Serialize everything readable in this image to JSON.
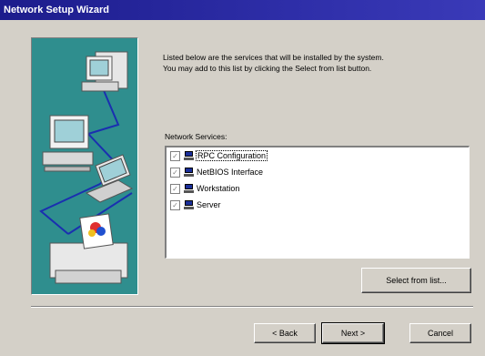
{
  "window": {
    "title": "Network Setup Wizard"
  },
  "instructions": {
    "line1": "Listed below are the services that will be installed by the system.",
    "line2": "You may add to this list by clicking the Select from list button."
  },
  "services": {
    "label": "Network Services:",
    "items": [
      {
        "label": "RPC Configuration",
        "checked": true,
        "selected": true
      },
      {
        "label": "NetBIOS Interface",
        "checked": true,
        "selected": false
      },
      {
        "label": "Workstation",
        "checked": true,
        "selected": false
      },
      {
        "label": "Server",
        "checked": true,
        "selected": false
      }
    ]
  },
  "buttons": {
    "select_from_list": "Select from list...",
    "back": "< Back",
    "next": "Next >",
    "cancel": "Cancel"
  },
  "colors": {
    "title_bar": "#1c1c8c",
    "illustration_bg": "#2f8e8e",
    "dialog_bg": "#d4d0c8",
    "network_lines": "#1a2fb0"
  },
  "icons": {
    "checkbox": "check-mark",
    "service": "network-computer-icon"
  }
}
